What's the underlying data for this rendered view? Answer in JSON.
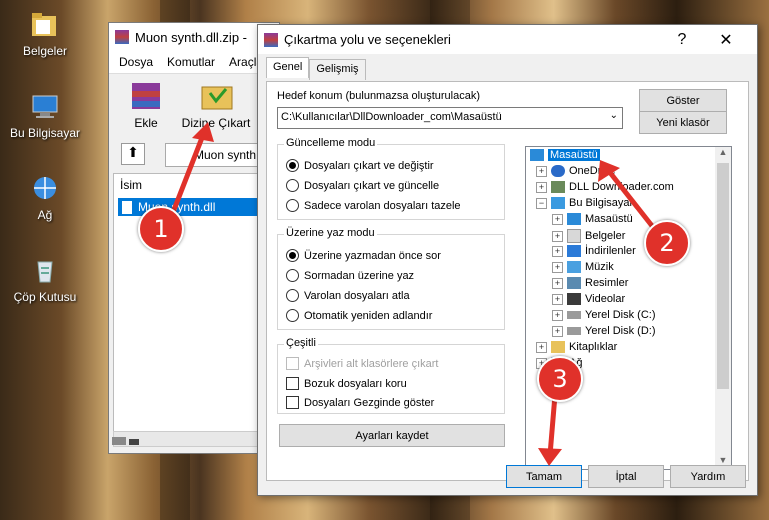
{
  "desktop": {
    "icons": [
      {
        "label": "Belgeler",
        "icon": "folder-documents-icon"
      },
      {
        "label": "Bu Bilgisayar",
        "icon": "computer-icon"
      },
      {
        "label": "Ağ",
        "icon": "network-icon"
      },
      {
        "label": "Çöp Kutusu",
        "icon": "recycle-bin-icon"
      }
    ]
  },
  "winrar": {
    "title": "Muon synth.dll.zip -",
    "menu": [
      "Dosya",
      "Komutlar",
      "Araçla"
    ],
    "toolbar": {
      "add_label": "Ekle",
      "extract_label": "Dizine Çıkart"
    },
    "address": "Muon synth",
    "list_header": "İsim",
    "file_name": "Muon synth.dll"
  },
  "dialog": {
    "title": "Çıkartma yolu ve seçenekleri",
    "help_glyph": "?",
    "close_glyph": "✕",
    "tabs": [
      "Genel",
      "Gelişmiş"
    ],
    "destination_label": "Hedef konum (bulunmazsa oluşturulacak)",
    "destination_value": "C:\\Kullanıcılar\\DllDownloader_com\\Masaüstü",
    "show_button": "Göster",
    "new_folder_button": "Yeni klasör",
    "update_mode": {
      "label": "Güncelleme modu",
      "options": [
        "Dosyaları çıkart ve değiştir",
        "Dosyaları çıkart ve güncelle",
        "Sadece varolan dosyaları tazele"
      ],
      "selected": 0
    },
    "overwrite_mode": {
      "label": "Üzerine yaz modu",
      "options": [
        "Üzerine yazmadan önce sor",
        "Sormadan üzerine yaz",
        "Varolan dosyaları atla",
        "Otomatik yeniden adlandır"
      ],
      "selected": 0
    },
    "misc": {
      "label": "Çeşitli",
      "options": [
        "Arşivleri alt klasörlere çıkart",
        "Bozuk dosyaları koru",
        "Dosyaları Gezginde göster"
      ]
    },
    "save_settings_button": "Ayarları kaydet",
    "tree": [
      {
        "label": "Masaüstü",
        "icon": "desktop-icon",
        "selected": true
      },
      {
        "label": "OneDrive",
        "icon": "onedrive-icon"
      },
      {
        "label": "DLL Downloader.com",
        "icon": "user-icon"
      },
      {
        "label": "Bu Bilgisayar",
        "icon": "computer-icon"
      },
      {
        "label": "Masaüstü",
        "icon": "desktop-icon"
      },
      {
        "label": "Belgeler",
        "icon": "documents-icon"
      },
      {
        "label": "İndirilenler",
        "icon": "downloads-icon"
      },
      {
        "label": "Müzik",
        "icon": "music-icon"
      },
      {
        "label": "Resimler",
        "icon": "pictures-icon"
      },
      {
        "label": "Videolar",
        "icon": "videos-icon"
      },
      {
        "label": "Yerel Disk (C:)",
        "icon": "drive-icon"
      },
      {
        "label": "Yerel Disk (D:)",
        "icon": "drive-icon"
      },
      {
        "label": "Kitaplıklar",
        "icon": "libraries-icon"
      },
      {
        "label": "Ağ",
        "icon": "network-icon"
      }
    ],
    "ok_button": "Tamam",
    "cancel_button": "İptal",
    "help_button": "Yardım"
  },
  "markers": [
    "1",
    "2",
    "3"
  ],
  "colors": {
    "marker": "#e0312a",
    "selection": "#0078d7",
    "arrow": "#e0312a"
  }
}
